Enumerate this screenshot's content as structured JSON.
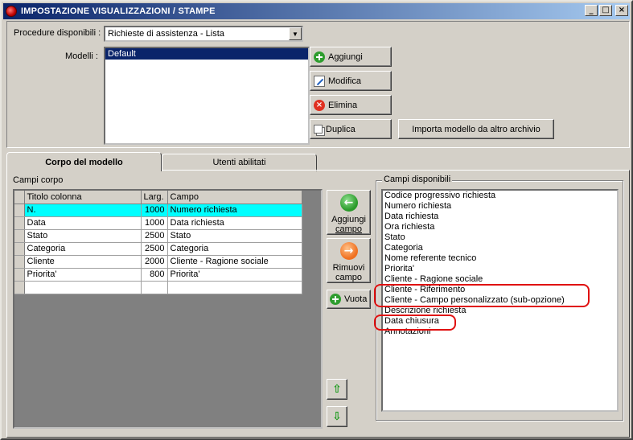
{
  "window": {
    "title": "IMPOSTAZIONE VISUALIZZAZIONI / STAMPE",
    "controls": {
      "minimize": "_",
      "maximize": "□",
      "close": "×"
    }
  },
  "top": {
    "procedure_label": "Procedure disponibili :",
    "procedure_value": "Richieste di assistenza - Lista",
    "modelli_label": "Modelli :",
    "modelli_items": [
      "Default"
    ],
    "buttons": {
      "add": "Aggiungi",
      "edit": "Modifica",
      "delete": "Elimina",
      "duplicate": "Duplica",
      "import": "Importa modello da altro archivio"
    }
  },
  "tabs": [
    "Corpo del modello",
    "Utenti abilitati"
  ],
  "corpo": {
    "group_label": "Campi corpo",
    "columns": [
      "Titolo colonna",
      "Larg.",
      "Campo"
    ],
    "rows": [
      [
        "N.",
        "1000",
        "Numero richiesta"
      ],
      [
        "Data",
        "1000",
        "Data richiesta"
      ],
      [
        "Stato",
        "2500",
        "Stato"
      ],
      [
        "Categoria",
        "2500",
        "Categoria"
      ],
      [
        "Cliente",
        "2000",
        "Cliente - Ragione sociale"
      ],
      [
        "Priorita'",
        "800",
        "Priorita'"
      ],
      [
        "",
        "",
        ""
      ]
    ]
  },
  "middle_buttons": {
    "add_field_1": "Aggiungi",
    "add_field_2": "campo",
    "remove_field_1": "Rimuovi",
    "remove_field_2": "campo",
    "clear": "Vuota",
    "add_icon": "←",
    "remove_icon": "→",
    "up_icon": "⇧",
    "down_icon": "⇩"
  },
  "available": {
    "group_label": "Campi disponibili",
    "items": [
      "Codice progressivo richiesta",
      "Numero richiesta",
      "Data richiesta",
      "Ora richiesta",
      "Stato",
      "Categoria",
      "Nome referente tecnico",
      "Priorita'",
      "Cliente - Ragione sociale",
      "Cliente - Riferimento",
      "Cliente - Campo personalizzato (sub-opzione)",
      "Descrizione richiesta",
      "Data chiusura",
      "Annotazioni"
    ]
  },
  "colors": {
    "titlebar_start": "#0a246a",
    "titlebar_end": "#a6caf0",
    "selected_row": "#00ffff",
    "annotation": "#e01010"
  }
}
